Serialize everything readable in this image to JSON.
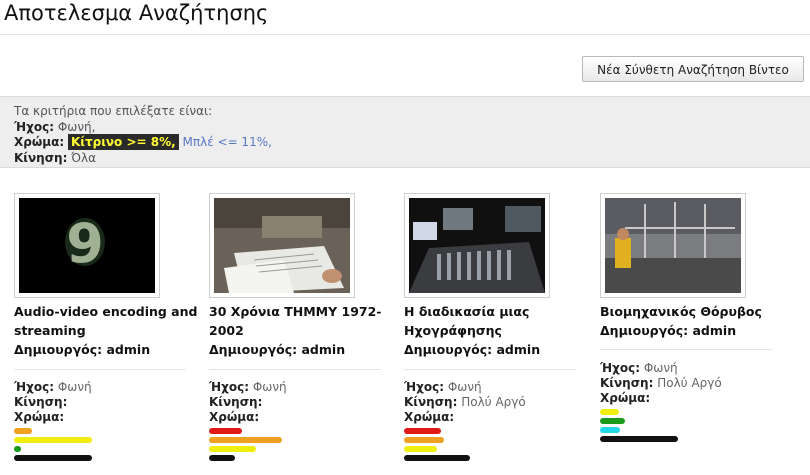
{
  "page": {
    "title": "Αποτελεσμα Αναζήτησης"
  },
  "actions": {
    "new_search_label": "Νέα Σύνθετη Αναζήτηση Βίντεο"
  },
  "criteria": {
    "intro": "Τα κριτήρια που επιλέξατε είναι:",
    "sound_label": "Ήχος:",
    "sound_value": "Φωνή,",
    "color_label": "Χρώμα:",
    "color_yellow": "Κίτρινο >= 8%,",
    "color_blue": "Μπλέ <= 11%,",
    "motion_label": "Κίνηση:",
    "motion_value": "Όλα"
  },
  "labels": {
    "creator": "Δημιουργός:",
    "sound": "Ήχος:",
    "motion": "Κίνηση:",
    "color": "Χρώμα:"
  },
  "colors": {
    "yellow": "#f0ee10",
    "orange": "#f0a020",
    "red": "#e01818",
    "green": "#1a9a1a",
    "black": "#111111",
    "cyan": "#20d8e8"
  },
  "results": [
    {
      "title": "Audio-video encoding and streaming",
      "creator": "admin",
      "sound": "Φωνή",
      "motion": "",
      "thumb_icon": "digit-nine-thumbnail",
      "color_bars": [
        {
          "color": "orange",
          "fraction": 0.23
        },
        {
          "color": "yellow",
          "fraction": 1.0
        },
        {
          "color": "green",
          "fraction": 0.09
        },
        {
          "color": "black",
          "fraction": 1.0
        }
      ]
    },
    {
      "title": "30 Χρόνια ΤΗΜΜΥ 1972-2002",
      "creator": "admin",
      "sound": "Φωνή",
      "motion": "",
      "thumb_icon": "documents-desk-thumbnail",
      "color_bars": [
        {
          "color": "red",
          "fraction": 0.42
        },
        {
          "color": "orange",
          "fraction": 0.94
        },
        {
          "color": "yellow",
          "fraction": 0.6
        },
        {
          "color": "black",
          "fraction": 0.33
        }
      ]
    },
    {
      "title": "Η διαδικασία μιας Ηχογράφησης",
      "creator": "admin",
      "sound": "Φωνή",
      "motion": "Πολύ Αργό",
      "thumb_icon": "mixing-console-thumbnail",
      "color_bars": [
        {
          "color": "red",
          "fraction": 0.47
        },
        {
          "color": "orange",
          "fraction": 0.52
        },
        {
          "color": "yellow",
          "fraction": 0.42
        },
        {
          "color": "black",
          "fraction": 0.85
        }
      ]
    },
    {
      "title": "Βιομηχανικός Θόρυβος",
      "creator": "admin",
      "sound": "Φωνή",
      "motion": "Πολύ Αργό",
      "thumb_icon": "factory-worker-thumbnail",
      "color_bars": [
        {
          "color": "yellow",
          "fraction": 0.24
        },
        {
          "color": "green",
          "fraction": 0.32
        },
        {
          "color": "cyan",
          "fraction": 0.26
        },
        {
          "color": "black",
          "fraction": 1.0
        }
      ]
    }
  ]
}
